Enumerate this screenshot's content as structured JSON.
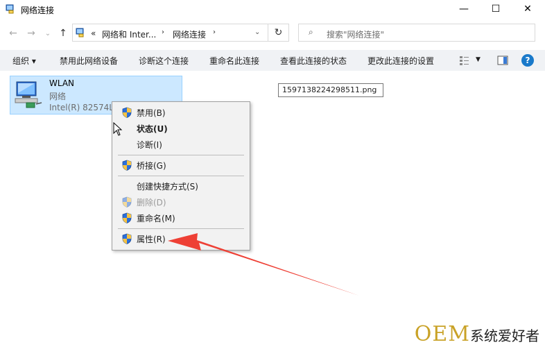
{
  "window": {
    "title": "网络连接",
    "controls": {
      "minimize": "—",
      "maximize": "☐",
      "close": "✕"
    }
  },
  "address": {
    "overflow": "«",
    "crumbs": [
      "网络和 Inter...",
      "网络连接"
    ],
    "search_placeholder": "搜索\"网络连接\""
  },
  "commands": {
    "organize": "组织 ▾",
    "disable": "禁用此网络设备",
    "diagnose": "诊断这个连接",
    "rename": "重命名此连接",
    "status": "查看此连接的状态",
    "settings": "更改此连接的设置"
  },
  "item": {
    "name": "WLAN",
    "type": "网络",
    "adapter": "Intel(R) 82574L"
  },
  "tooltip": "1597138224298511.png",
  "context_menu": [
    {
      "label": "禁用(B)",
      "shield": true,
      "bold": false,
      "disabled": false
    },
    {
      "label": "状态(U)",
      "shield": false,
      "bold": true,
      "disabled": false
    },
    {
      "label": "诊断(I)",
      "shield": false,
      "bold": false,
      "disabled": false
    },
    {
      "label": "桥接(G)",
      "shield": true,
      "bold": false,
      "disabled": false
    },
    {
      "label": "创建快捷方式(S)",
      "shield": false,
      "bold": false,
      "disabled": false
    },
    {
      "label": "删除(D)",
      "shield": true,
      "bold": false,
      "disabled": true
    },
    {
      "label": "重命名(M)",
      "shield": true,
      "bold": false,
      "disabled": false
    },
    {
      "label": "属性(R)",
      "shield": true,
      "bold": false,
      "disabled": false
    }
  ],
  "watermark": {
    "brand": "OEM",
    "text": "系统爱好者"
  },
  "colors": {
    "selection": "#cce8ff",
    "arrow": "#ee4035",
    "help": "#1979ca",
    "watermark_gold": "#c9a227"
  }
}
